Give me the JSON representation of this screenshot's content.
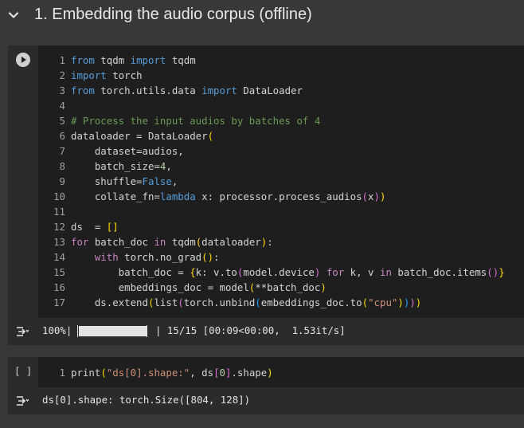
{
  "section": {
    "title": "1. Embedding the audio corpus (offline)"
  },
  "cell1": {
    "lines": [
      {
        "n": "1",
        "tokens": [
          [
            "kw2",
            "from"
          ],
          [
            "def",
            " tqdm "
          ],
          [
            "kw2",
            "import"
          ],
          [
            "def",
            " tqdm"
          ]
        ]
      },
      {
        "n": "2",
        "tokens": [
          [
            "kw2",
            "import"
          ],
          [
            "def",
            " torch"
          ]
        ]
      },
      {
        "n": "3",
        "tokens": [
          [
            "kw2",
            "from"
          ],
          [
            "def",
            " torch.utils.data "
          ],
          [
            "kw2",
            "import"
          ],
          [
            "def",
            " DataLoader"
          ]
        ]
      },
      {
        "n": "4",
        "tokens": []
      },
      {
        "n": "5",
        "tokens": [
          [
            "cmt",
            "# Process the input audios by batches of 4"
          ]
        ]
      },
      {
        "n": "6",
        "tokens": [
          [
            "def",
            "dataloader = DataLoader"
          ],
          [
            "b1",
            "("
          ]
        ]
      },
      {
        "n": "7",
        "tokens": [
          [
            "def",
            "    dataset=audios,"
          ]
        ]
      },
      {
        "n": "8",
        "tokens": [
          [
            "def",
            "    batch_size="
          ],
          [
            "num",
            "4"
          ],
          [
            "def",
            ","
          ]
        ]
      },
      {
        "n": "9",
        "tokens": [
          [
            "def",
            "    shuffle="
          ],
          [
            "kw2",
            "False"
          ],
          [
            "def",
            ","
          ]
        ]
      },
      {
        "n": "10",
        "tokens": [
          [
            "def",
            "    collate_fn="
          ],
          [
            "kw2",
            "lambda"
          ],
          [
            "def",
            " x: processor.process_audios"
          ],
          [
            "b2",
            "("
          ],
          [
            "def",
            "x"
          ],
          [
            "b2",
            ")"
          ],
          [
            "b1",
            ")"
          ]
        ]
      },
      {
        "n": "11",
        "tokens": []
      },
      {
        "n": "12",
        "tokens": [
          [
            "def",
            "ds  = "
          ],
          [
            "b1",
            "[]"
          ]
        ]
      },
      {
        "n": "13",
        "tokens": [
          [
            "kw",
            "for"
          ],
          [
            "def",
            " batch_doc "
          ],
          [
            "kw",
            "in"
          ],
          [
            "def",
            " tqdm"
          ],
          [
            "b1",
            "("
          ],
          [
            "def",
            "dataloader"
          ],
          [
            "b1",
            ")"
          ],
          [
            "def",
            ":"
          ]
        ]
      },
      {
        "n": "14",
        "tokens": [
          [
            "def",
            "    "
          ],
          [
            "kw",
            "with"
          ],
          [
            "def",
            " torch.no_grad"
          ],
          [
            "b1",
            "()"
          ],
          [
            "def",
            ":"
          ]
        ]
      },
      {
        "n": "15",
        "tokens": [
          [
            "def",
            "        batch_doc = "
          ],
          [
            "b1",
            "{"
          ],
          [
            "def",
            "k: v.to"
          ],
          [
            "b2",
            "("
          ],
          [
            "def",
            "model.device"
          ],
          [
            "b2",
            ")"
          ],
          [
            "def",
            " "
          ],
          [
            "kw",
            "for"
          ],
          [
            "def",
            " k, v "
          ],
          [
            "kw",
            "in"
          ],
          [
            "def",
            " batch_doc.items"
          ],
          [
            "b2",
            "()"
          ],
          [
            "b1",
            "}"
          ]
        ]
      },
      {
        "n": "16",
        "tokens": [
          [
            "def",
            "        embeddings_doc = model"
          ],
          [
            "b1",
            "("
          ],
          [
            "def",
            "**batch_doc"
          ],
          [
            "b1",
            ")"
          ]
        ]
      },
      {
        "n": "17",
        "tokens": [
          [
            "def",
            "    ds.extend"
          ],
          [
            "b1",
            "("
          ],
          [
            "def",
            "list"
          ],
          [
            "b2",
            "("
          ],
          [
            "def",
            "torch.unbind"
          ],
          [
            "b3",
            "("
          ],
          [
            "def",
            "embeddings_doc.to"
          ],
          [
            "b1",
            "("
          ],
          [
            "str",
            "\"cpu\""
          ],
          [
            "b1",
            ")"
          ],
          [
            "b3",
            ")"
          ],
          [
            "b2",
            ")"
          ],
          [
            "b1",
            ")"
          ]
        ]
      }
    ]
  },
  "output1": {
    "percent": "100%|",
    "progress_fraction": 1.0,
    "stats": "| 15/15 [00:09<00:00,  1.53it/s]"
  },
  "cell2": {
    "exec_count": "[ ]",
    "lines": [
      {
        "n": "1",
        "tokens": [
          [
            "def",
            "print"
          ],
          [
            "b1",
            "("
          ],
          [
            "str",
            "\"ds[0].shape:\""
          ],
          [
            "def",
            ", ds"
          ],
          [
            "b2",
            "["
          ],
          [
            "num",
            "0"
          ],
          [
            "b2",
            "]"
          ],
          [
            "def",
            ".shape"
          ],
          [
            "b1",
            ")"
          ]
        ]
      }
    ]
  },
  "output2": {
    "text": "ds[0].shape: torch.Size([804, 128])"
  },
  "colors": {
    "background": "#383838",
    "cell": "#1e1e1e",
    "gutter": "#2b2b2b"
  }
}
